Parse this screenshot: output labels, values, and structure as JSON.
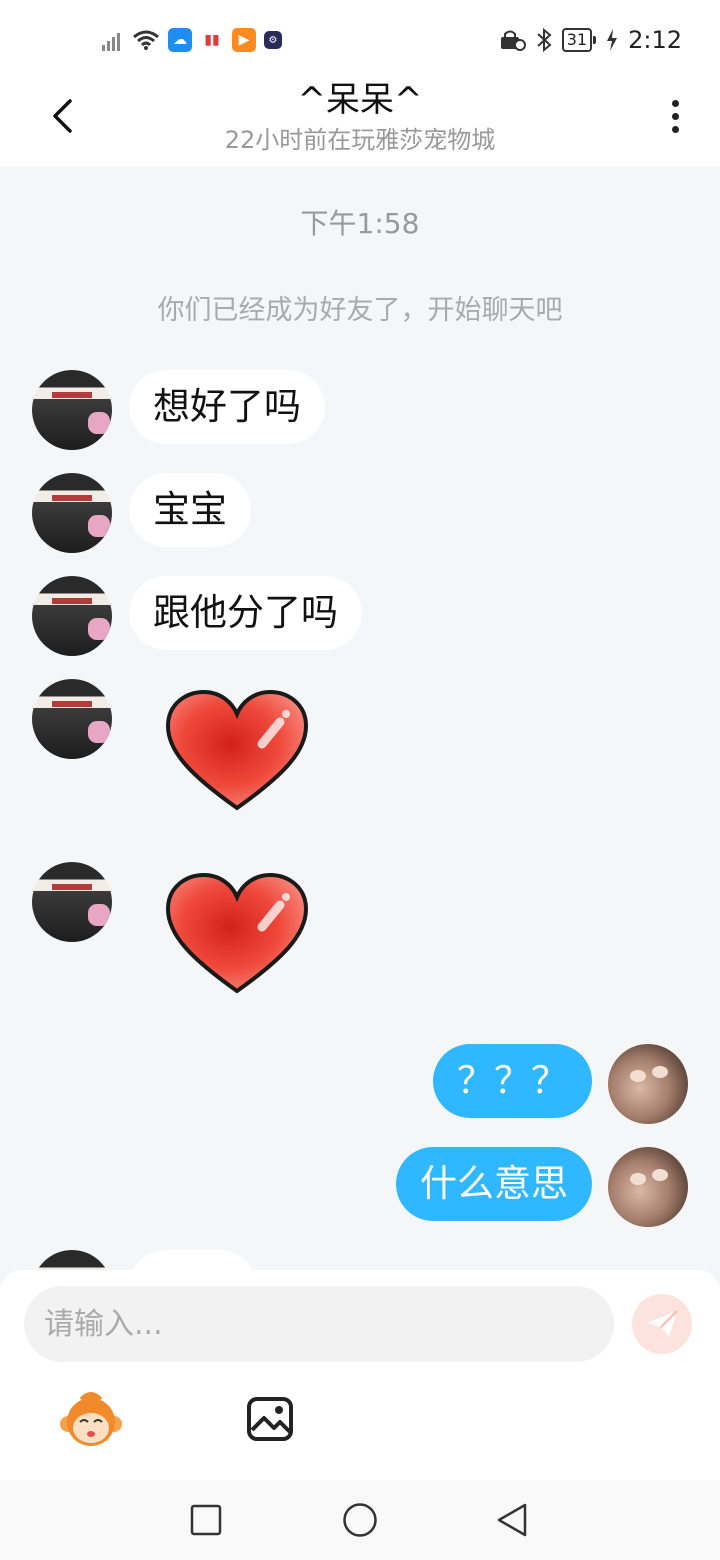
{
  "status_bar": {
    "time": "2:12",
    "battery": "31"
  },
  "header": {
    "title": "^呆呆^",
    "subtitle": "22小时前在玩雅莎宠物城"
  },
  "chat": {
    "timestamp": "下午1:58",
    "system_message": "你们已经成为好友了，开始聊天吧",
    "messages": [
      {
        "from": "them",
        "type": "text",
        "text": "想好了吗"
      },
      {
        "from": "them",
        "type": "text",
        "text": "宝宝"
      },
      {
        "from": "them",
        "type": "text",
        "text": "跟他分了吗"
      },
      {
        "from": "them",
        "type": "sticker",
        "sticker": "heart-sticker"
      },
      {
        "from": "them",
        "type": "sticker",
        "sticker": "heart-sticker"
      },
      {
        "from": "me",
        "type": "text",
        "text": "？？？"
      },
      {
        "from": "me",
        "type": "text",
        "text": "什么意思"
      }
    ]
  },
  "input": {
    "placeholder": "请输入..."
  },
  "colors": {
    "my_bubble": "#2fb8ff",
    "their_bubble": "#ffffff",
    "background": "#f5f6f8",
    "send_button": "#fde3de"
  },
  "icons": {
    "back": "chevron-left-icon",
    "more": "more-vertical-icon",
    "send": "send-icon",
    "emoji": "monkey-emoji-icon",
    "image": "image-icon",
    "nav_recent": "square-icon",
    "nav_home": "circle-icon",
    "nav_back": "triangle-back-icon"
  }
}
